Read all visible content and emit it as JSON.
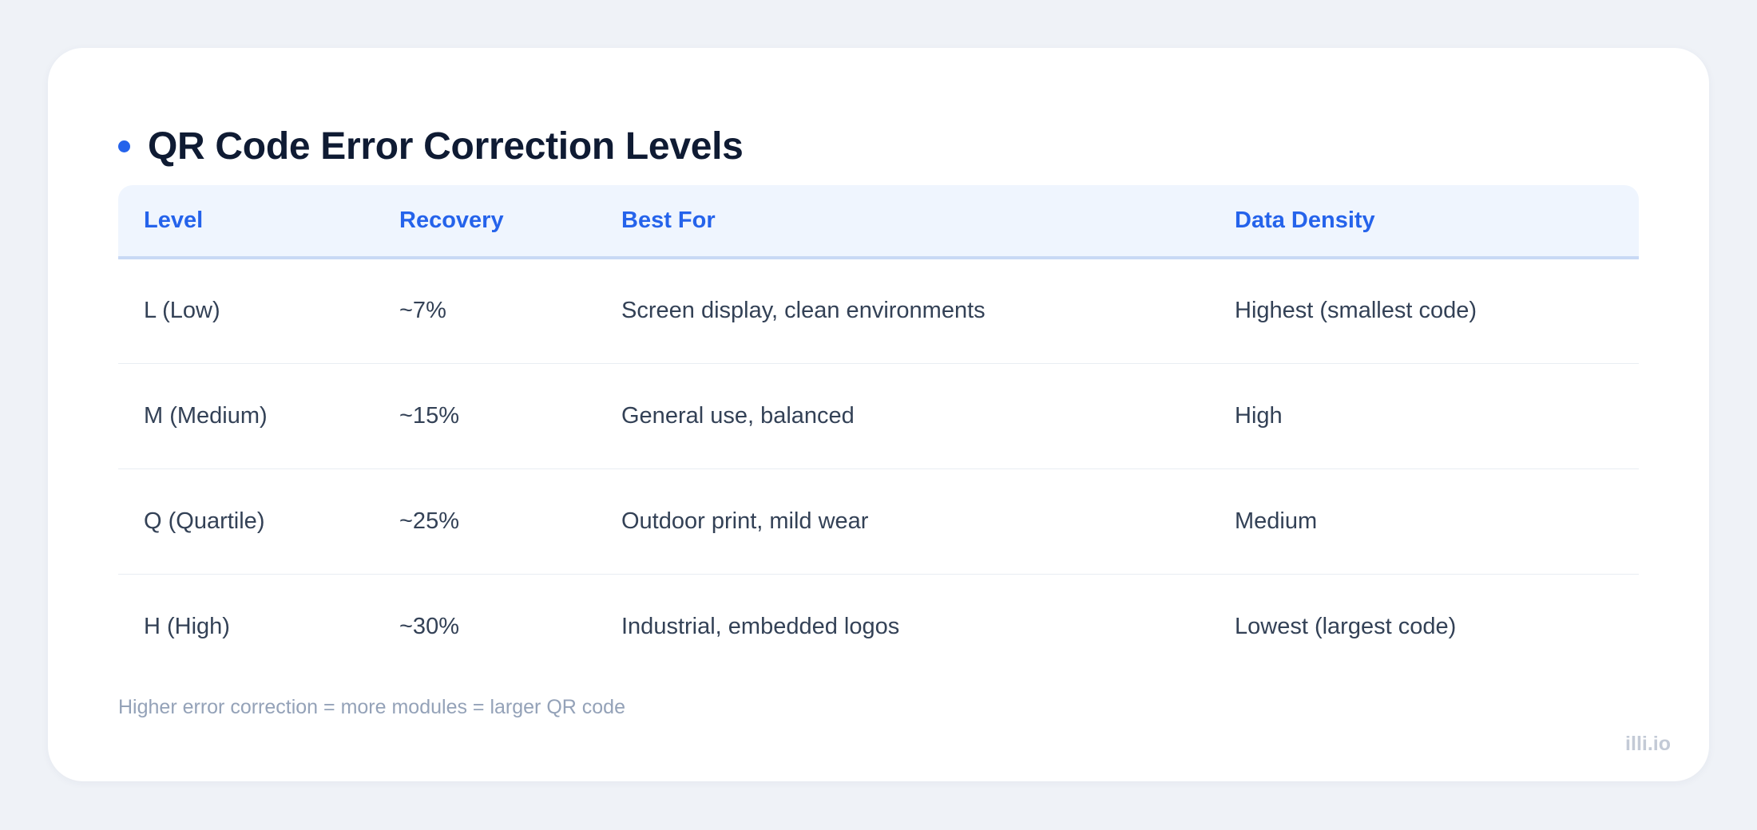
{
  "title": "QR Code Error Correction Levels",
  "columns": [
    "Level",
    "Recovery",
    "Best For",
    "Data Density"
  ],
  "rows": [
    [
      "L (Low)",
      "~7%",
      "Screen display, clean environments",
      "Highest (smallest code)"
    ],
    [
      "M (Medium)",
      "~15%",
      "General use, balanced",
      "High"
    ],
    [
      "Q (Quartile)",
      "~25%",
      "Outdoor print, mild wear",
      "Medium"
    ],
    [
      "H (High)",
      "~30%",
      "Industrial, embedded logos",
      "Lowest (largest code)"
    ]
  ],
  "footnote": "Higher error correction = more modules = larger QR code",
  "watermark": "illi.io",
  "colors": {
    "accent": "#2563eb",
    "title": "#0f1b33",
    "body_text": "#334156",
    "muted_text": "#94a2b8",
    "header_bg": "#eff5fe",
    "page_bg": "#eff2f7"
  }
}
